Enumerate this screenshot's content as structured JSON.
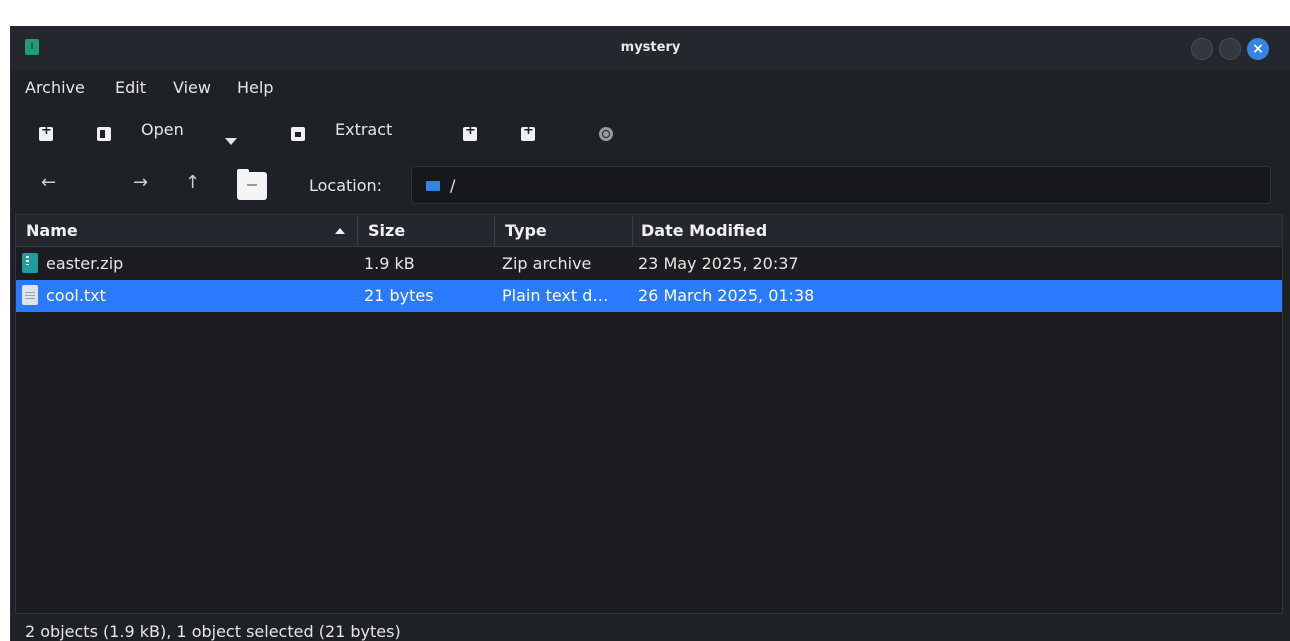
{
  "window": {
    "title": "mystery",
    "close_glyph": "×",
    "accent": "#3584e4"
  },
  "menu": {
    "items": [
      "Archive",
      "Edit",
      "View",
      "Help"
    ]
  },
  "toolbar": {
    "open_label": "Open",
    "extract_label": "Extract"
  },
  "location": {
    "label": "Location:",
    "path": "/"
  },
  "columns": [
    "Name",
    "Size",
    "Type",
    "Date Modified"
  ],
  "files": [
    {
      "name": "easter.zip",
      "size": "1.9 kB",
      "type": "Zip archive",
      "modified": "23 May 2025, 20:37",
      "icon": "zip-file-icon"
    },
    {
      "name": "cool.txt",
      "size": "21 bytes",
      "type": "Plain text d…",
      "modified": "26 March 2025, 01:38",
      "icon": "text-file-icon",
      "selected": true
    }
  ],
  "status": {
    "text": "2 objects (1.9 kB), 1 object selected (21 bytes)"
  },
  "colors": {
    "selection": "#2a7bff",
    "background": "#1e2126"
  }
}
